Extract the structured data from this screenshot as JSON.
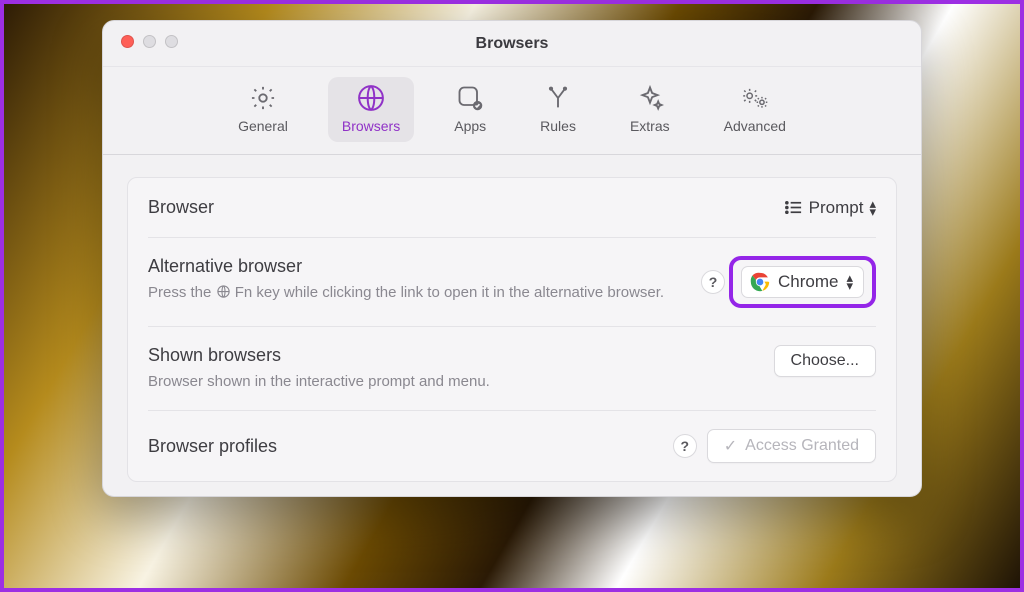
{
  "window": {
    "title": "Browsers"
  },
  "tabs": {
    "general": {
      "label": "General"
    },
    "browsers": {
      "label": "Browsers"
    },
    "apps": {
      "label": "Apps"
    },
    "rules": {
      "label": "Rules"
    },
    "extras": {
      "label": "Extras"
    },
    "advanced": {
      "label": "Advanced"
    }
  },
  "sections": {
    "browser": {
      "title": "Browser",
      "selector_label": "Prompt"
    },
    "alt_browser": {
      "title": "Alternative browser",
      "desc_pre": "Press the ",
      "desc_post": " Fn key while clicking the link to open it in the alternative browser.",
      "selected": "Chrome"
    },
    "shown": {
      "title": "Shown browsers",
      "desc": "Browser shown in the interactive prompt and menu.",
      "button": "Choose..."
    },
    "profiles": {
      "title": "Browser profiles",
      "status": "Access Granted",
      "help": "?"
    }
  }
}
